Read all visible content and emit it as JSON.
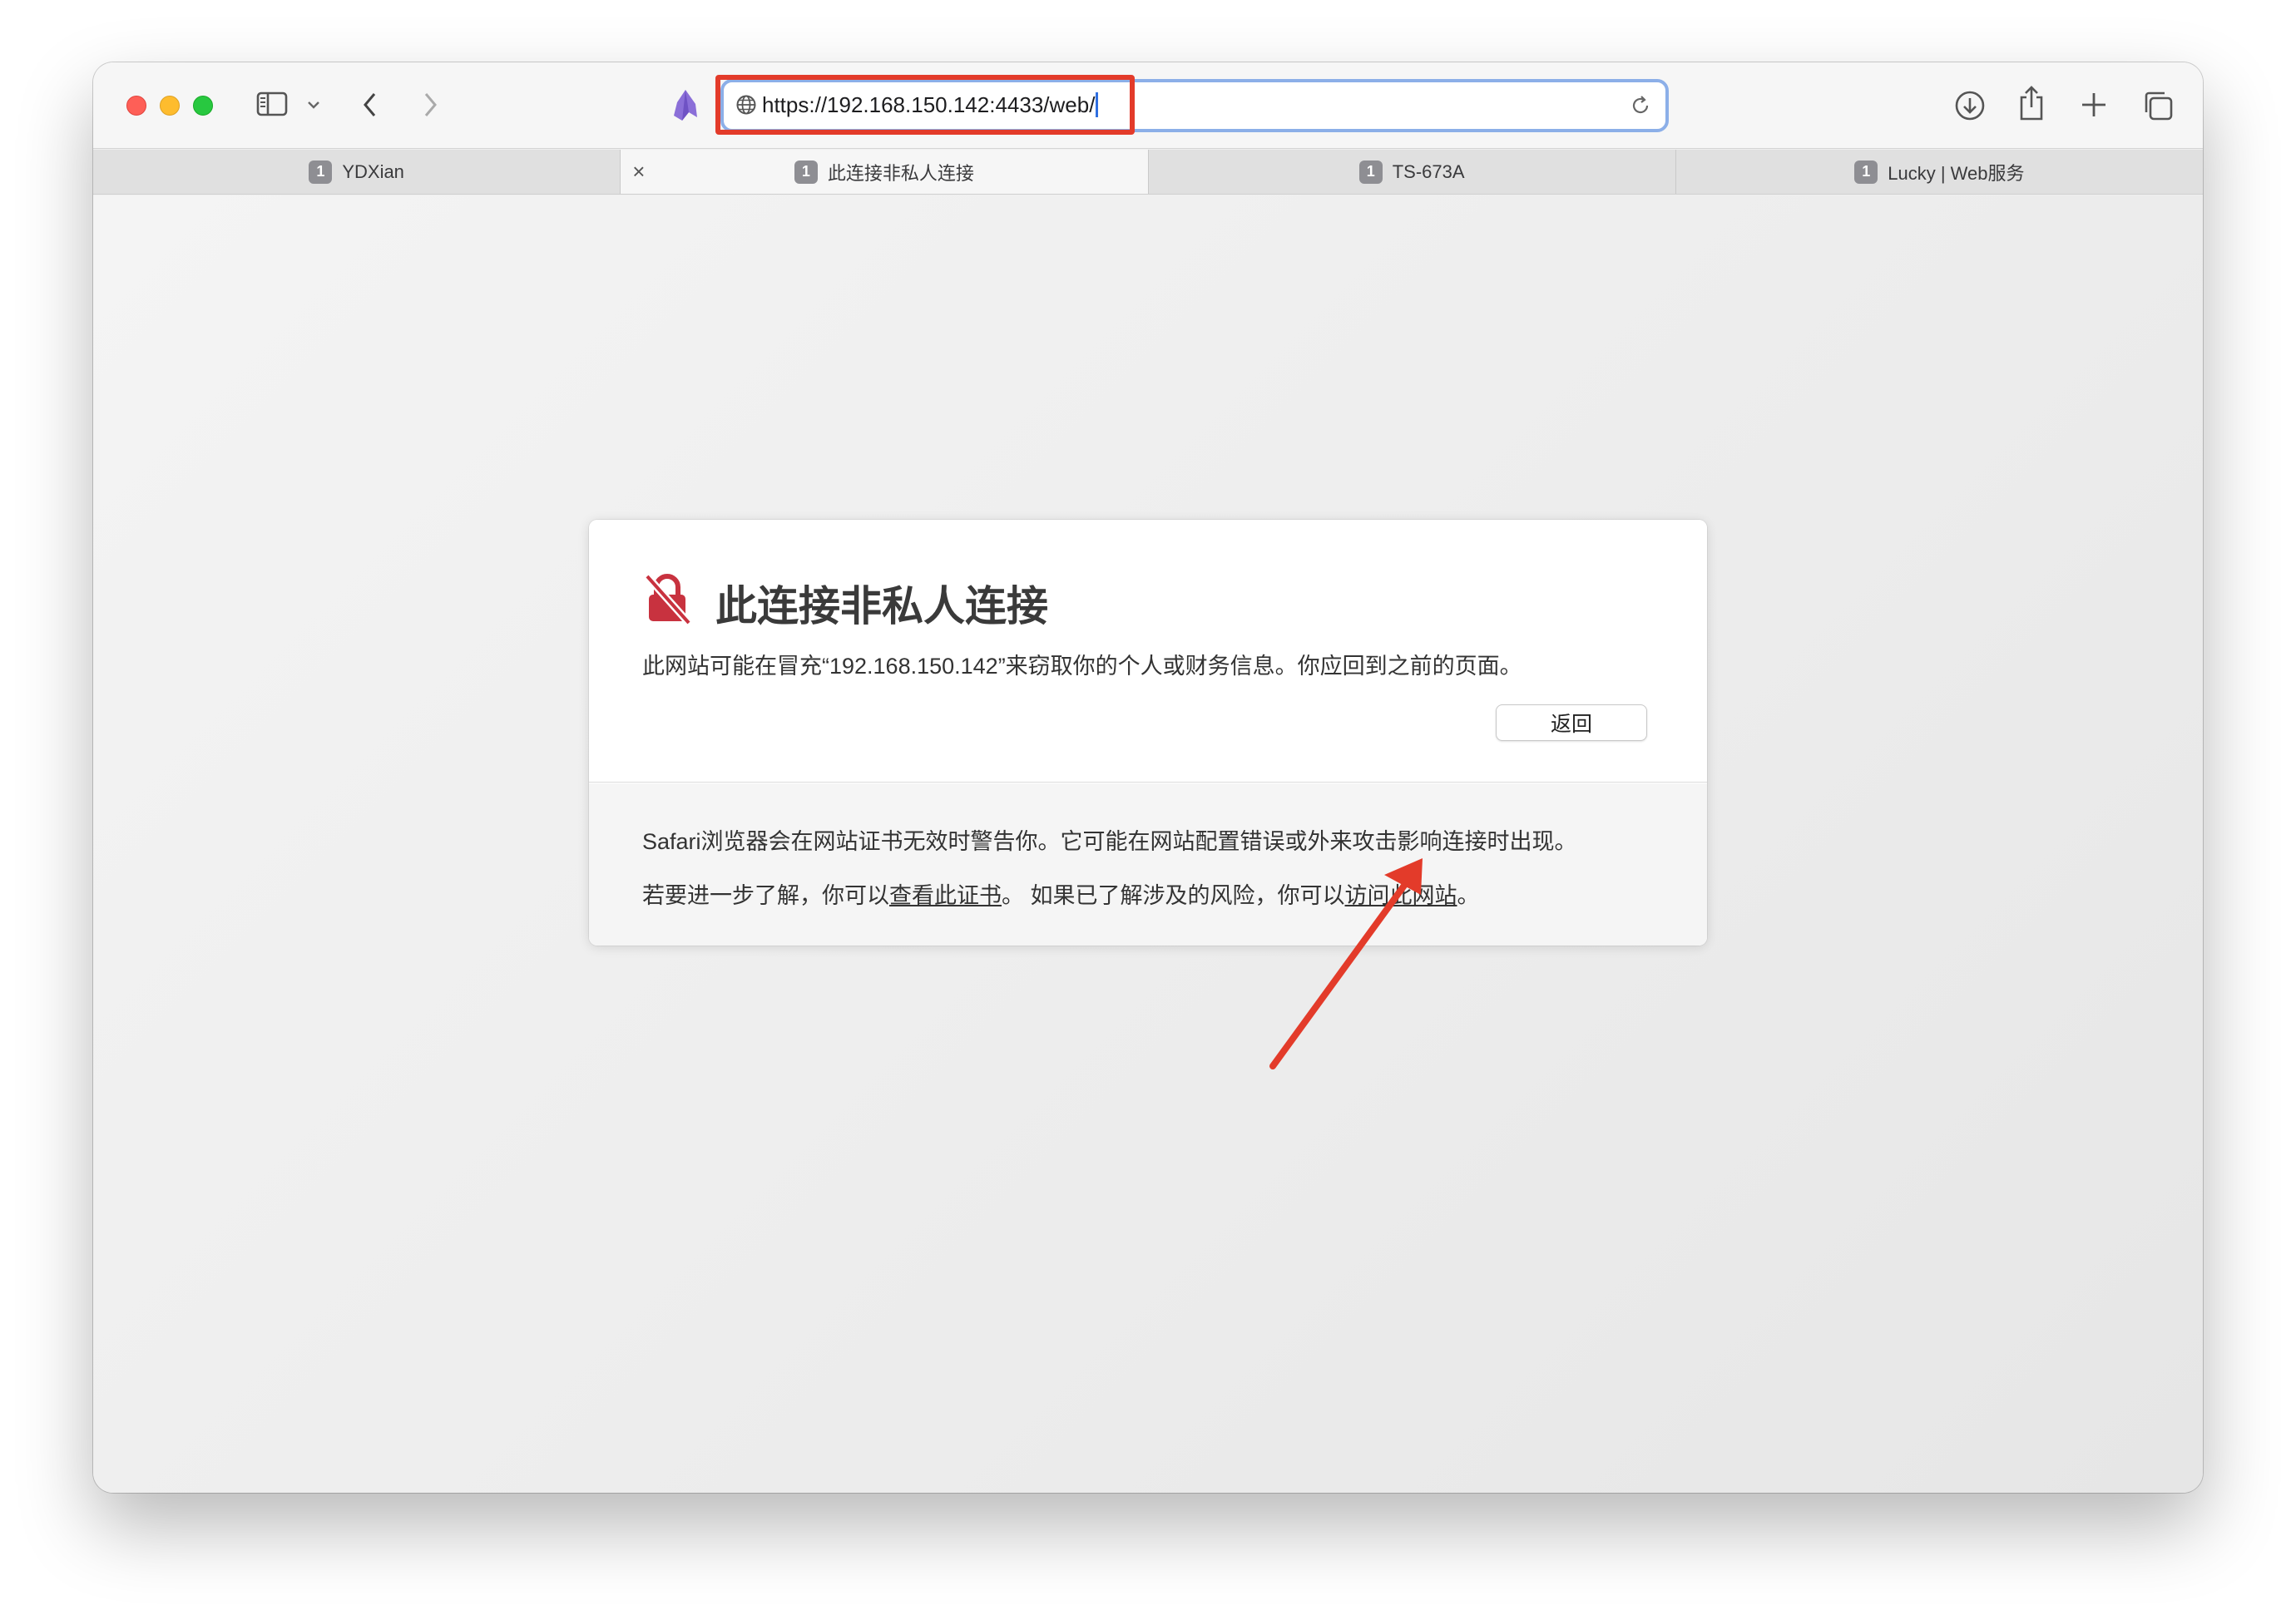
{
  "browser": {
    "url": "https://192.168.150.142:4433/web/",
    "tabs": [
      {
        "badge": "1",
        "label": "YDXian"
      },
      {
        "badge": "1",
        "label": "此连接非私人连接"
      },
      {
        "badge": "1",
        "label": "TS-673A"
      },
      {
        "badge": "1",
        "label": "Lucky | Web服务"
      }
    ],
    "tab_close_glyph": "×"
  },
  "warning": {
    "title": "此连接非私人连接",
    "message": "此网站可能在冒充“192.168.150.142”来窃取你的个人或财务信息。你应回到之前的页面。",
    "back_button": "返回",
    "info_line1": "Safari浏览器会在网站证书无效时警告你。它可能在网站配置错误或外来攻击影响连接时出现。",
    "info_line2_prefix": "若要进一步了解，你可以",
    "view_cert_link": "查看此证书",
    "info_line2_middle": "。 如果已了解涉及的风险，你可以",
    "visit_site_link": "访问此网站",
    "info_line2_suffix": "。"
  },
  "colors": {
    "annotation_red": "#e33b2a",
    "lock_red": "#c8323f",
    "url_focus_ring": "#8cafe8"
  },
  "icons": [
    "sidebar-icon",
    "chevron-down-icon",
    "back-icon",
    "forward-icon",
    "extension-icon",
    "globe-icon",
    "reload-icon",
    "download-icon",
    "share-icon",
    "new-tab-icon",
    "tab-overview-icon",
    "lock-broken-icon"
  ]
}
